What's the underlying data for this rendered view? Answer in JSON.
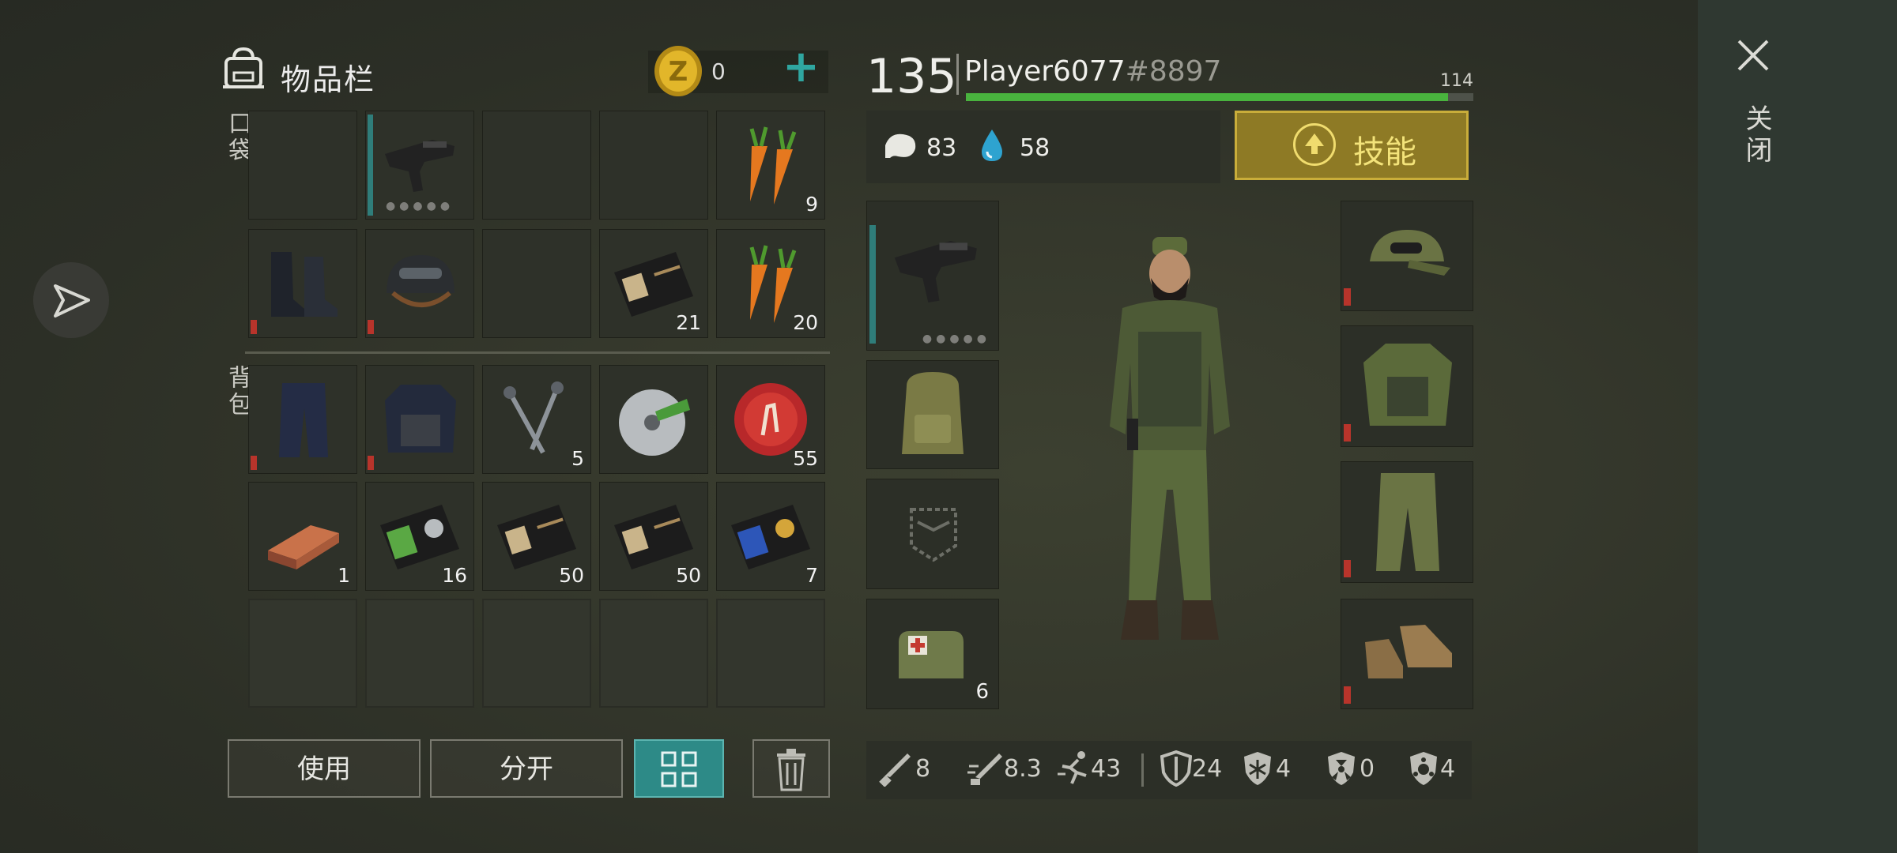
{
  "inventory": {
    "title": "物品栏",
    "coins": "0",
    "pocket_label": "口袋",
    "backpack_label": "背包",
    "slots": {
      "r1c5_qty": "9",
      "r2c4_qty": "21",
      "r2c5_qty": "20",
      "r3c3_qty": "5",
      "r3c5_qty": "55",
      "r4c1_qty": "1",
      "r4c2_qty": "16",
      "r4c3_qty": "50",
      "r4c4_qty": "50",
      "r4c5_qty": "7"
    },
    "buttons": {
      "use": "使用",
      "split": "分开"
    }
  },
  "player": {
    "level": "135",
    "name": "Player6077",
    "tag": "#8897",
    "xp_value": "114",
    "xp_fraction": 0.95,
    "hunger": "83",
    "thirst": "58",
    "skills_label": "技能",
    "medkit_qty": "6"
  },
  "combat_stats": {
    "melee_damage": "8",
    "melee_speed": "8.3",
    "move_speed": "43",
    "armor": "24",
    "cold_resist": "4",
    "radiation_resist": "0",
    "infection_resist": "4"
  },
  "close_label": "关闭",
  "colors": {
    "accent_teal": "#2d8a87",
    "skill_gold": "#c9ad3a",
    "xp_green": "#49b33e",
    "durability_red": "#b8342b"
  },
  "icons": [
    "backpack-icon",
    "coin-icon",
    "plus-icon",
    "uzi-icon",
    "carrot-icon",
    "boots-icon",
    "helmet-icon",
    "id-card-icon",
    "pants-icon",
    "vest-icon",
    "nails-icon",
    "saw-blade-icon",
    "bottle-cap-icon",
    "copper-ingot-icon",
    "police-badge-icon",
    "grid-view-icon",
    "trash-icon",
    "stomach-icon",
    "water-drop-icon",
    "arrow-up-icon",
    "cap-icon",
    "jacket-icon",
    "shoes-icon",
    "pocket-icon",
    "medkit-icon",
    "close-icon",
    "send-icon"
  ]
}
